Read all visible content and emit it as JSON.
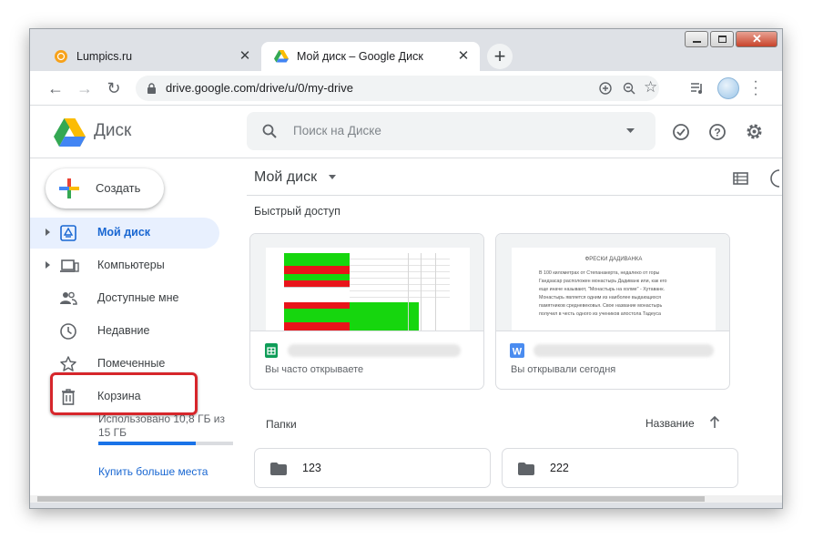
{
  "tabs": [
    {
      "title": "Lumpics.ru",
      "active": false,
      "favicon": "orange-circle-icon"
    },
    {
      "title": "Мой диск – Google Диск",
      "active": true,
      "favicon": "google-drive-icon"
    }
  ],
  "toolbar": {
    "url": "drive.google.com/drive/u/0/my-drive"
  },
  "header": {
    "app_name": "Диск",
    "search_placeholder": "Поиск на Диске"
  },
  "sidebar": {
    "create_label": "Создать",
    "items": [
      {
        "label": "Мой диск",
        "icon": "drive-icon",
        "active": true
      },
      {
        "label": "Компьютеры",
        "icon": "computer-icon"
      },
      {
        "label": "Доступные мне",
        "icon": "people-icon"
      },
      {
        "label": "Недавние",
        "icon": "clock-icon"
      },
      {
        "label": "Помеченные",
        "icon": "star-icon"
      },
      {
        "label": "Корзина",
        "icon": "trash-icon",
        "highlighted": true
      }
    ],
    "storage": {
      "text": "Использовано 10,8 ГБ из 15 ГБ",
      "fraction": 0.72
    },
    "buy_more": "Купить больше места"
  },
  "main": {
    "title": "Мой диск",
    "quick_access_label": "Быстрый доступ",
    "cards": [
      {
        "type": "sheets",
        "subtitle": "Вы часто открываете"
      },
      {
        "type": "docs",
        "subtitle": "Вы открывали сегодня",
        "preview_title": "ФРЕСКИ ДАДИВАНКА",
        "preview_lines": [
          "В 100 километрах от Степанакерта, недалеко от горы",
          "Гандзасар расположен монастырь Дадиванк или, как его",
          "еще иначе называют, \"Монастырь на холме\" - Хутаванк.",
          "Монастырь является одним из наиболее выдающихся",
          "памятников средневековья. Свое название монастырь",
          "получил в честь одного из учеников апостола Тадеуса"
        ]
      }
    ],
    "folders_label": "Папки",
    "sort_label": "Название",
    "folders": [
      {
        "name": "123"
      },
      {
        "name": "222"
      }
    ]
  },
  "colors": {
    "accent": "#1967d2",
    "highlight_red": "#d6262b"
  }
}
